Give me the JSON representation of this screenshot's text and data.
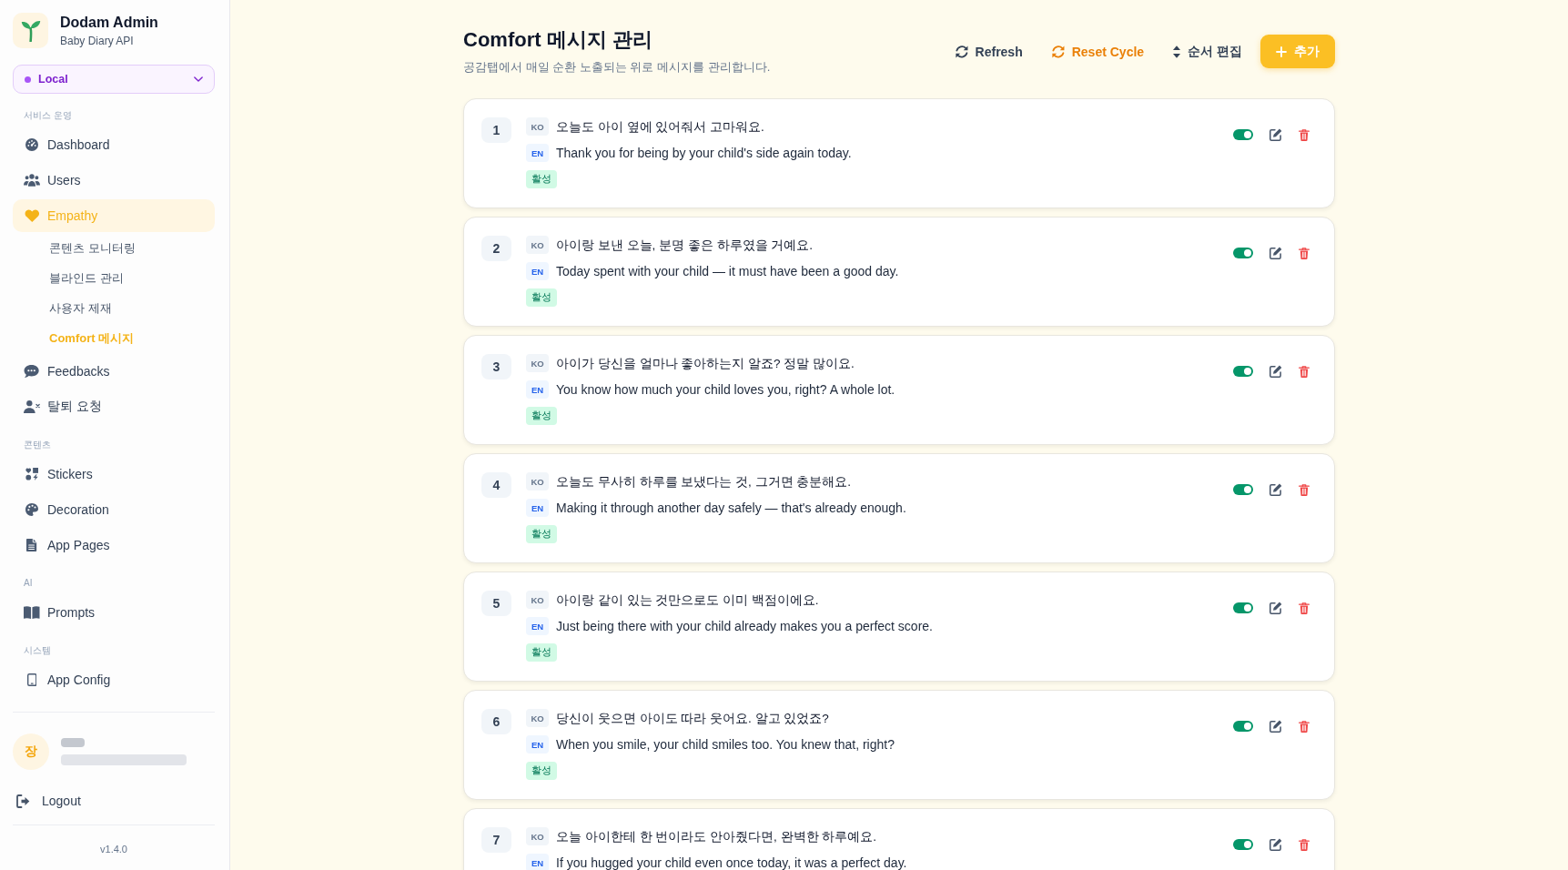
{
  "sidebar": {
    "brand": {
      "title": "Dodam Admin",
      "subtitle": "Baby Diary API"
    },
    "environment": {
      "value": "Local"
    },
    "sections": [
      {
        "label": "서비스 운영",
        "items": [
          {
            "label": "Dashboard",
            "selected": false
          },
          {
            "label": "Users",
            "selected": false
          },
          {
            "label": "Empathy",
            "selected": true,
            "children": [
              {
                "label": "콘텐츠 모니터링",
                "selected": false
              },
              {
                "label": "블라인드 관리",
                "selected": false
              },
              {
                "label": "사용자 제재",
                "selected": false
              },
              {
                "label": "Comfort 메시지",
                "selected": true
              }
            ]
          },
          {
            "label": "Feedbacks",
            "selected": false
          },
          {
            "label": "탈퇴 요청",
            "selected": false
          }
        ]
      },
      {
        "label": "콘텐츠",
        "items": [
          {
            "label": "Stickers",
            "selected": false
          },
          {
            "label": "Decoration",
            "selected": false
          },
          {
            "label": "App Pages",
            "selected": false
          }
        ]
      },
      {
        "label": "AI",
        "items": [
          {
            "label": "Prompts",
            "selected": false
          }
        ]
      },
      {
        "label": "시스템",
        "items": [
          {
            "label": "App Config",
            "selected": false
          }
        ]
      }
    ],
    "user": {
      "initial": "장"
    },
    "logout": "Logout",
    "version": "v1.4.0"
  },
  "page": {
    "title": "Comfort 메시지 관리",
    "subtitle": "공감탭에서 매일 순환 노출되는 위로 메시지를 관리합니다.",
    "actions": [
      {
        "label": "Refresh",
        "kind": "plain"
      },
      {
        "label": "Reset Cycle",
        "kind": "warning"
      },
      {
        "label": "순서 편집",
        "kind": "plain"
      },
      {
        "label": "추가",
        "kind": "primary"
      }
    ]
  },
  "messages": [
    {
      "number": "1",
      "ko_tag": "KO",
      "ko": "오늘도 아이 옆에 있어줘서 고마워요.",
      "en_tag": "EN",
      "en": "Thank you for being by your child's side again today.",
      "status": "활성",
      "on": true
    },
    {
      "number": "2",
      "ko_tag": "KO",
      "ko": "아이랑 보낸 오늘, 분명 좋은 하루였을 거예요.",
      "en_tag": "EN",
      "en": "Today spent with your child — it must have been a good day.",
      "status": "활성",
      "on": true
    },
    {
      "number": "3",
      "ko_tag": "KO",
      "ko": "아이가 당신을 얼마나 좋아하는지 알죠? 정말 많이요.",
      "en_tag": "EN",
      "en": "You know how much your child loves you, right? A whole lot.",
      "status": "활성",
      "on": true
    },
    {
      "number": "4",
      "ko_tag": "KO",
      "ko": "오늘도 무사히 하루를 보냈다는 것, 그거면 충분해요.",
      "en_tag": "EN",
      "en": "Making it through another day safely — that's already enough.",
      "status": "활성",
      "on": true
    },
    {
      "number": "5",
      "ko_tag": "KO",
      "ko": "아이랑 같이 있는 것만으로도 이미 백점이에요.",
      "en_tag": "EN",
      "en": "Just being there with your child already makes you a perfect score.",
      "status": "활성",
      "on": true
    },
    {
      "number": "6",
      "ko_tag": "KO",
      "ko": "당신이 웃으면 아이도 따라 웃어요. 알고 있었죠?",
      "en_tag": "EN",
      "en": "When you smile, your child smiles too. You knew that, right?",
      "status": "활성",
      "on": true
    },
    {
      "number": "7",
      "ko_tag": "KO",
      "ko": "오늘 아이한테 한 번이라도 안아줬다면, 완벽한 하루예요.",
      "en_tag": "EN",
      "en": "If you hugged your child even once today, it was a perfect day.",
      "on": true
    }
  ]
}
